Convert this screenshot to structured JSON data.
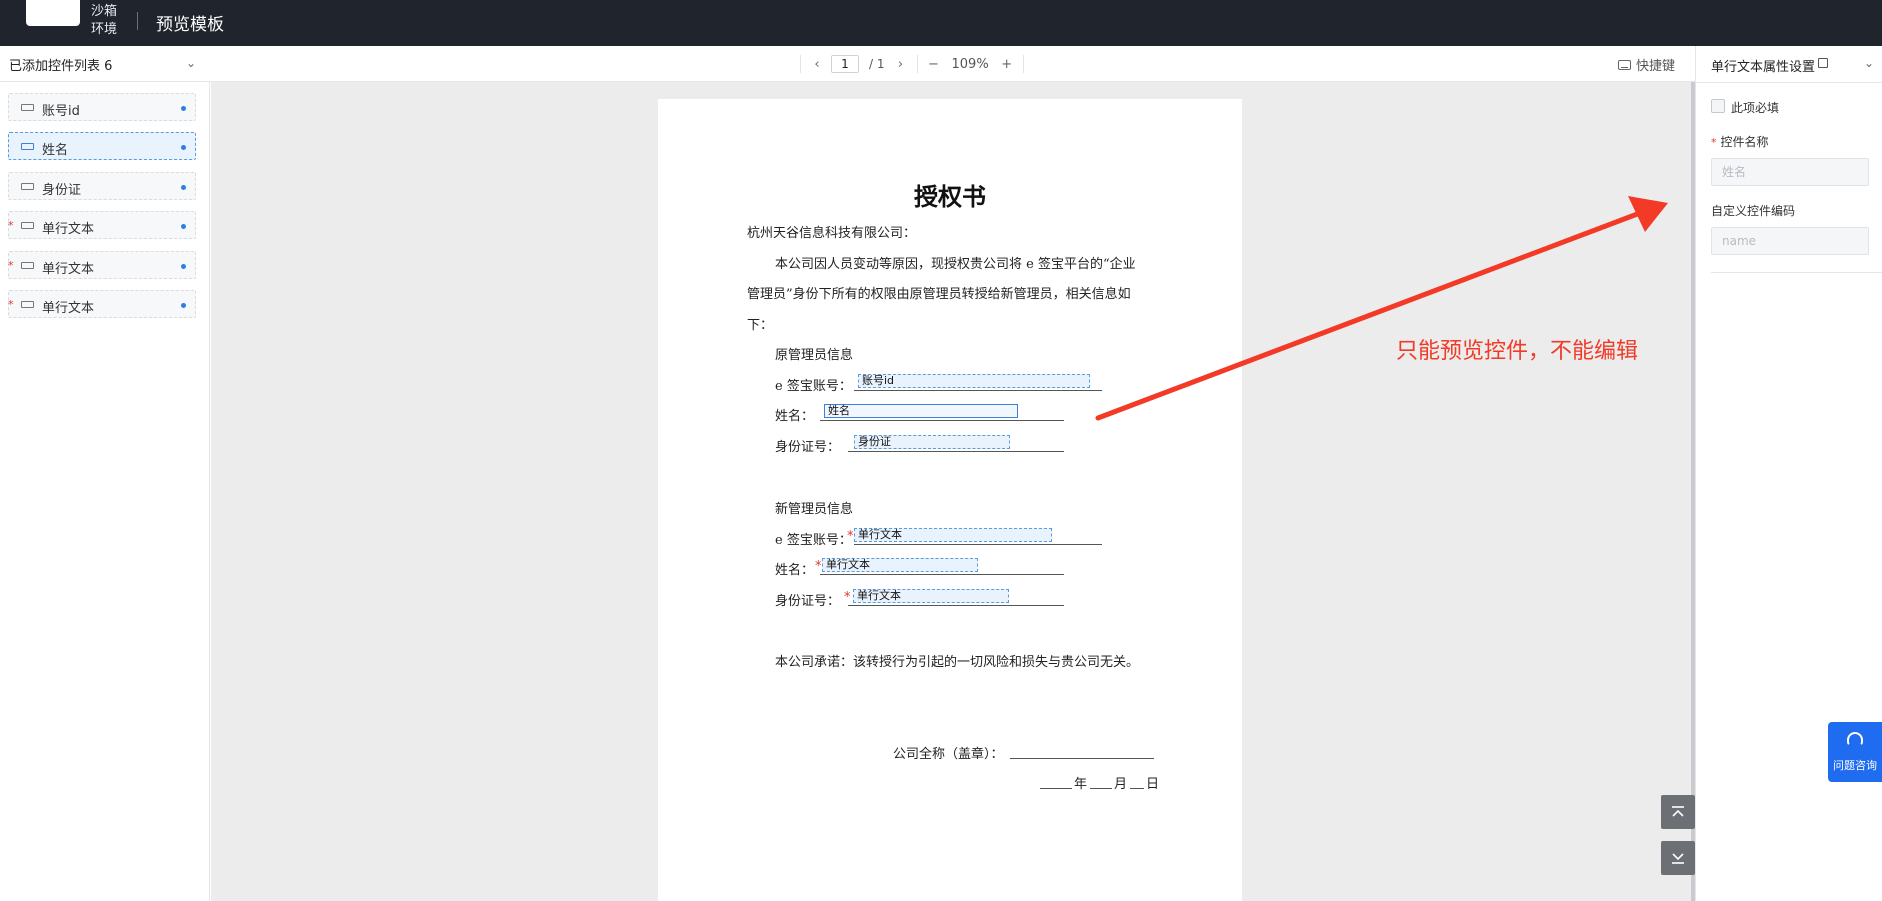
{
  "header": {
    "env_label": "沙箱环境",
    "title": "预览模板"
  },
  "toolbar": {
    "list_title": "已添加控件列表 6",
    "page_current": "1",
    "page_total": "/ 1",
    "zoom": "109%",
    "shortcut_label": "快捷键"
  },
  "controls": [
    {
      "label": "账号id",
      "required": false,
      "active": false
    },
    {
      "label": "姓名",
      "required": false,
      "active": true
    },
    {
      "label": "身份证",
      "required": false,
      "active": false
    },
    {
      "label": "单行文本",
      "required": true,
      "active": false
    },
    {
      "label": "单行文本",
      "required": true,
      "active": false
    },
    {
      "label": "单行文本",
      "required": true,
      "active": false
    }
  ],
  "document": {
    "title": "授权书",
    "addressee": "杭州天谷信息科技有限公司：",
    "para1_line1": "本公司因人员变动等原因，现授权贵公司将 e 签宝平台的“企业",
    "para1_line2": "管理员”身份下所有的权限由原管理员转授给新管理员，相关信息如",
    "para1_line3": "下：",
    "old_admin_heading": "原管理员信息",
    "account_label": "e 签宝账号：",
    "name_label": "姓名：",
    "id_label": "身份证号：",
    "old_account_field": "账号id",
    "old_name_field": "姓名",
    "old_id_field": "身份证",
    "new_admin_heading": "新管理员信息",
    "new_account_field": "单行文本",
    "new_name_field": "单行文本",
    "new_id_field": "单行文本",
    "req_star": "*",
    "promise": "本公司承诺：该转授行为引起的一切风险和损失与贵公司无关。",
    "company_label": "公司全称（盖章）：",
    "date_year": "年",
    "date_month": "月",
    "date_day": "日"
  },
  "annotation": {
    "text": "只能预览控件，不能编辑",
    "color": "#f23a26"
  },
  "right_panel": {
    "title": "单行文本属性设置",
    "required_checkbox_label": "此项必填",
    "required_star": "*",
    "name_label": "控件名称",
    "name_placeholder": "姓名",
    "code_label": "自定义控件编码",
    "code_placeholder": "name"
  },
  "help": {
    "label": "问题咨询"
  },
  "colors": {
    "header_bg": "#20242c",
    "accent": "#2f7fe0",
    "canvas_bg": "#ececec",
    "help_btn": "#1f6cf0"
  }
}
